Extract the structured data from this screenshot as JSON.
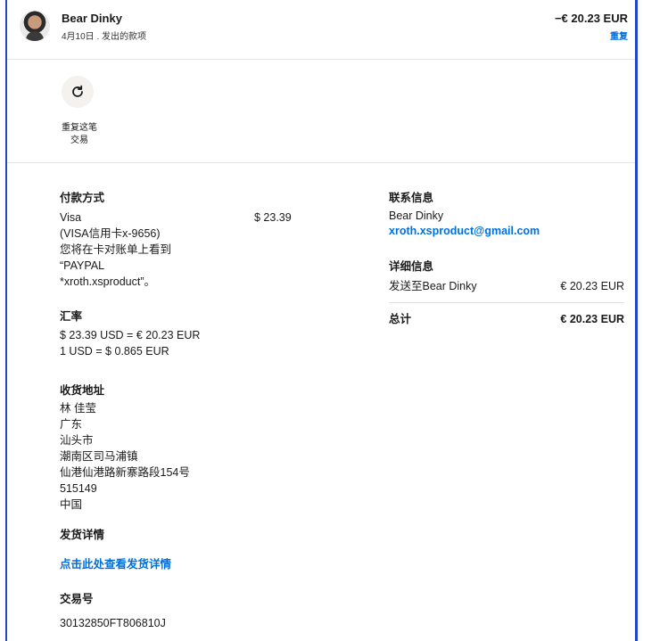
{
  "header": {
    "name": "Bear Dinky",
    "subline": "4月10日 . 发出的款项",
    "amount": "−€ 20.23 EUR",
    "repeat_link": "重复"
  },
  "action": {
    "icon": "refresh-icon",
    "label_line1": "重复这笔",
    "label_line2": "交易"
  },
  "payment": {
    "title": "付款方式",
    "card": "Visa",
    "card_amount": "$ 23.39",
    "card_detail": "(VISA信用卡x-9656)",
    "statement_line1": "您将在卡对账单上看到",
    "statement_line2": "“PAYPAL",
    "statement_line3": "*xroth.xsproduct”。"
  },
  "exchange": {
    "title": "汇率",
    "line1": "$ 23.39 USD = € 20.23 EUR",
    "line2": "1 USD = $ 0.865 EUR"
  },
  "shipping": {
    "title": "收货地址",
    "lines": [
      "林 佳莹",
      "广东",
      "汕头市",
      "潮南区司马浦镇",
      "仙港仙港路新寨路段154号",
      "515149",
      "中国"
    ]
  },
  "delivery": {
    "title": "发货详情",
    "link": "点击此处查看发货详情"
  },
  "transaction": {
    "title": "交易号",
    "id": "30132850FT806810J"
  },
  "contact": {
    "title": "联系信息",
    "name": "Bear Dinky",
    "email": "xroth.xsproduct@gmail.com"
  },
  "details": {
    "title": "详细信息",
    "sent_to_label": "发送至Bear Dinky",
    "sent_to_amount": "€ 20.23 EUR",
    "total_label": "总计",
    "total_amount": "€ 20.23 EUR"
  },
  "colors": {
    "accent": "#0070e0",
    "frame": "#1f46c8"
  }
}
